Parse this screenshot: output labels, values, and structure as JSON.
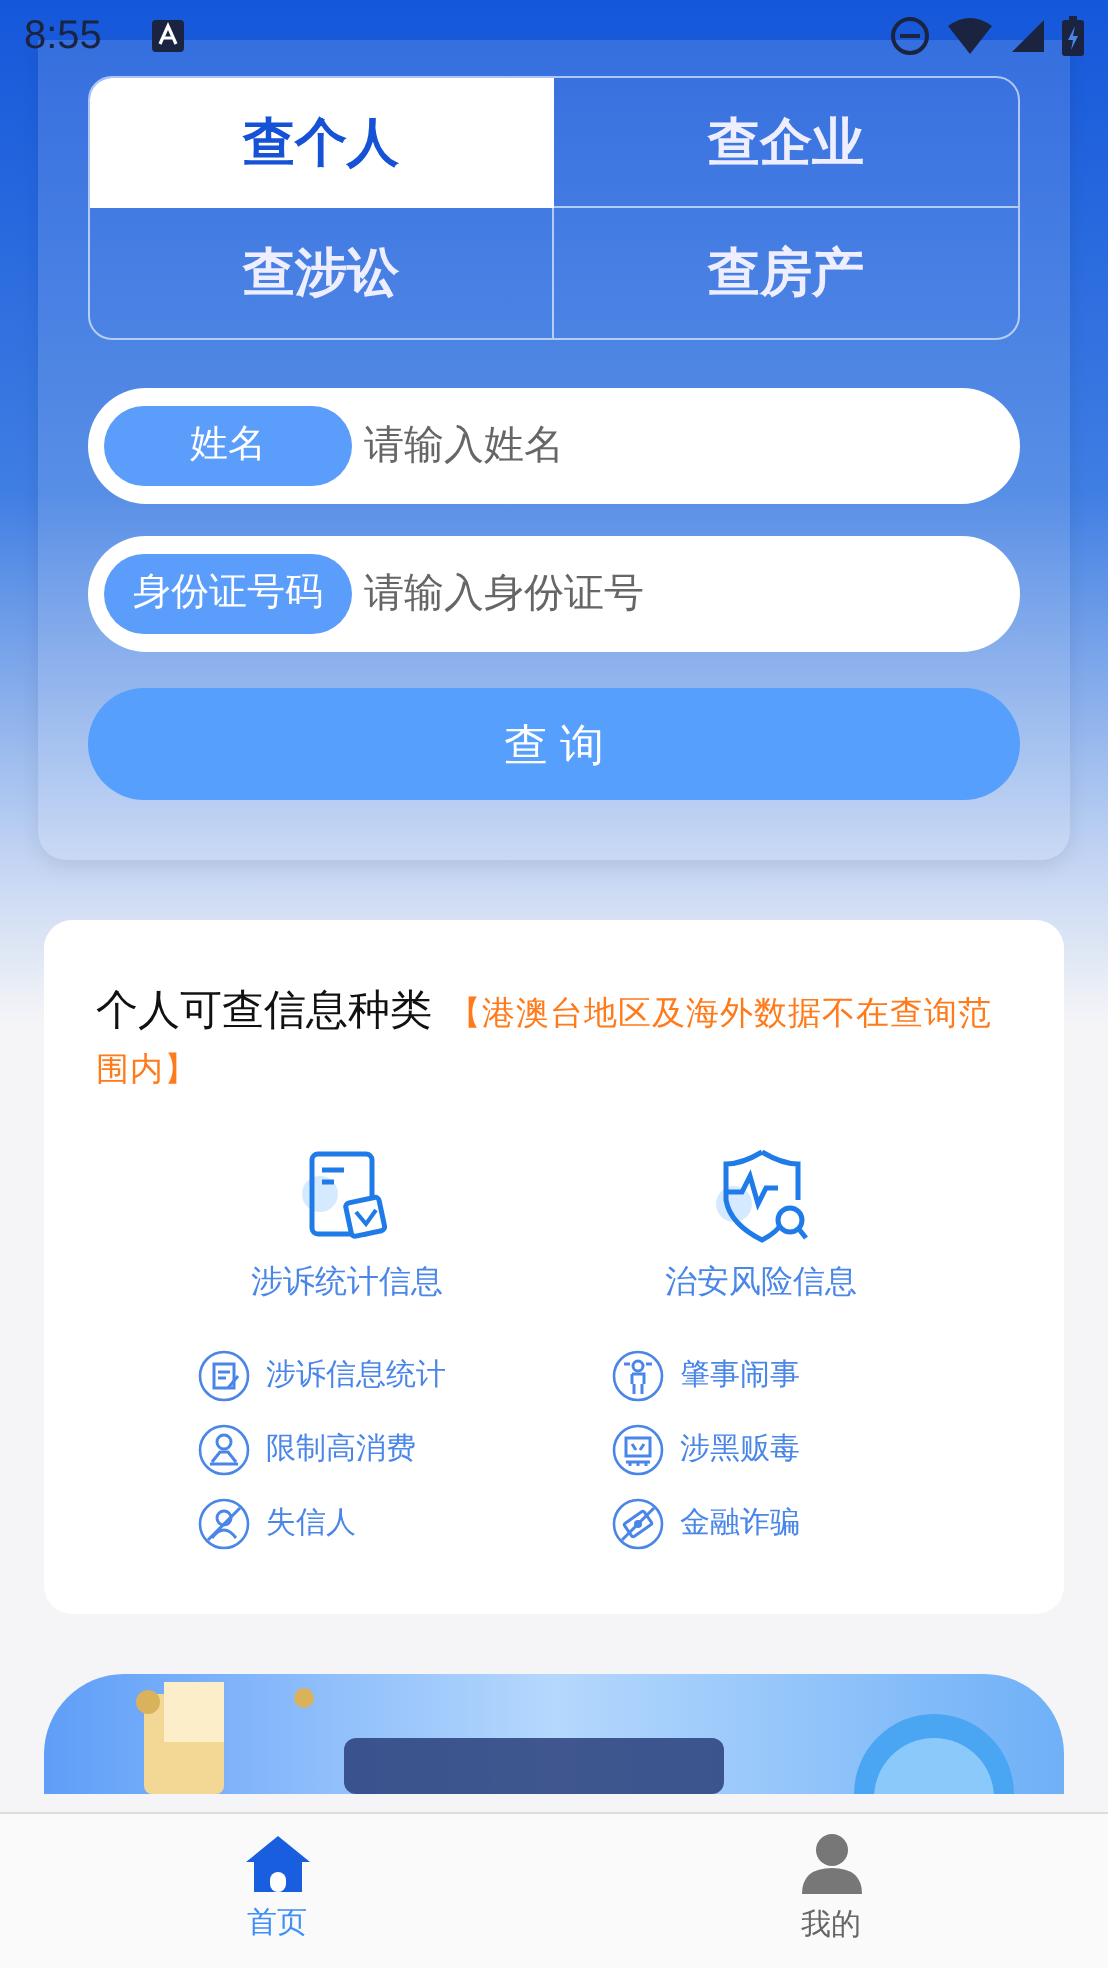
{
  "status_bar": {
    "time": "8:55"
  },
  "tabs": [
    {
      "label": "查个人",
      "selected": true
    },
    {
      "label": "查企业",
      "selected": false
    },
    {
      "label": "查涉讼",
      "selected": false
    },
    {
      "label": "查房产",
      "selected": false
    }
  ],
  "fields": [
    {
      "label": "姓名",
      "placeholder": "请输入姓名"
    },
    {
      "label": "身份证号码",
      "placeholder": "请输入身份证号"
    }
  ],
  "search_button": "查 询",
  "info": {
    "title": "个人可查信息种类",
    "note": "【港澳台地区及海外数据不在查询范围内】",
    "categories": [
      {
        "label": "涉诉统计信息",
        "items": [
          "涉诉信息统计",
          "限制高消费",
          "失信人"
        ]
      },
      {
        "label": "治安风险信息",
        "items": [
          "肇事闹事",
          "涉黑贩毒",
          "金融诈骗"
        ]
      }
    ]
  },
  "bottom_nav": [
    {
      "label": "首页",
      "selected": true
    },
    {
      "label": "我的",
      "selected": false
    }
  ]
}
